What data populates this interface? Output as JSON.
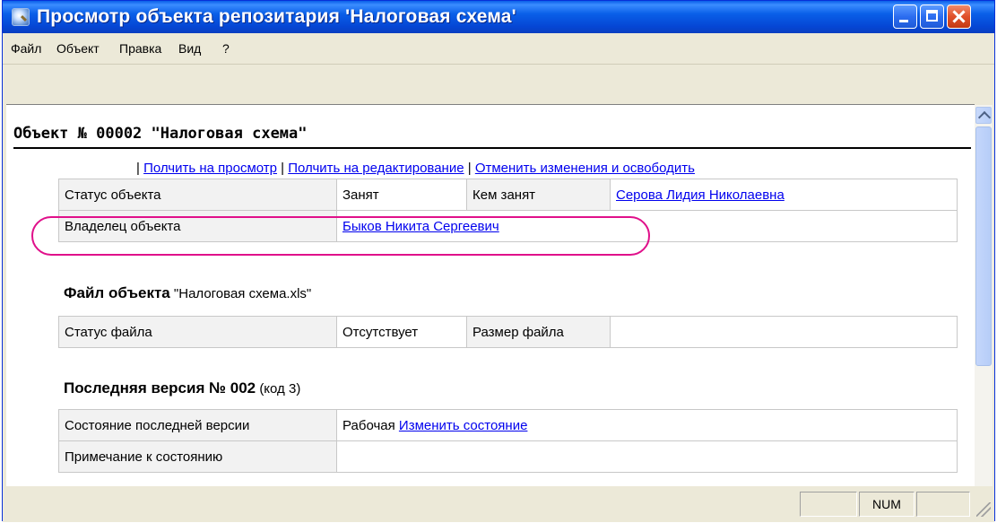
{
  "window": {
    "title": "Просмотр объекта репозитария 'Налоговая схема'",
    "title_color": "#ffffff",
    "titlebar_color": "#0a5fe8"
  },
  "menu": [
    "Файл",
    "Объект",
    "Правка",
    "Вид",
    "?"
  ],
  "object": {
    "header": "Объект № 00002 \"Налоговая схема\""
  },
  "actions": {
    "sep": "|",
    "view": "Полчить на просмотр",
    "edit": "Полчить на редактирование",
    "cancel": "Отменить изменения и освободить"
  },
  "info_table": {
    "status_label": "Статус объекта",
    "status_value": "Занят",
    "taken_by_label": "Кем занят",
    "taken_by_value": "Серова Лидия Николаевна",
    "owner_label": "Владелец объекта",
    "owner_value": "Быков Никита Сергеевич"
  },
  "file_section": {
    "heading": "Файл объекта",
    "filename": "\"Налоговая схема.xls\"",
    "file_status_label": "Статус файла",
    "file_status_value": "Отсутствует",
    "file_size_label": "Размер файла",
    "file_size_value": ""
  },
  "version_section": {
    "heading": "Последняя версия № 002",
    "code": "(код 3)",
    "state_label": "Состояние последней версии",
    "state_value": "Рабочая",
    "change_state_link": "Изменить состояние",
    "note_label": "Примечание к состоянию",
    "note_value": ""
  },
  "highlight_color": "#e0108a",
  "statusbar": {
    "panes": [
      "",
      "NUM",
      ""
    ]
  }
}
